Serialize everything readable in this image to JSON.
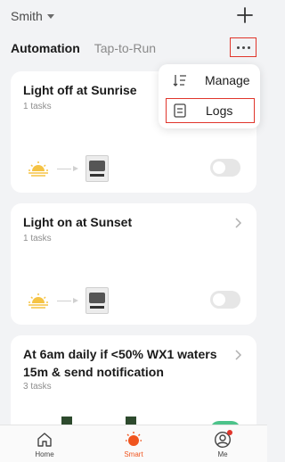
{
  "header": {
    "home_name": "Smith"
  },
  "tabs": [
    {
      "label": "Automation",
      "active": true
    },
    {
      "label": "Tap-to-Run",
      "active": false
    }
  ],
  "menu": {
    "items": [
      {
        "label": "Manage",
        "icon": "sort-list-icon"
      },
      {
        "label": "Logs",
        "icon": "log-document-icon"
      }
    ]
  },
  "cards": [
    {
      "title": "Light off at Sunrise",
      "subtitle": "1 tasks",
      "enabled": false
    },
    {
      "title": "Light on at Sunset",
      "subtitle": "1 tasks",
      "enabled": false
    },
    {
      "title": "At 6am daily if <50% WX1 waters 15m & send notification",
      "subtitle": "3 tasks",
      "enabled": true
    }
  ],
  "tabbar": [
    {
      "label": "Home",
      "icon": "home-icon",
      "active": false
    },
    {
      "label": "Smart",
      "icon": "smart-sun-icon",
      "active": true
    },
    {
      "label": "Me",
      "icon": "profile-icon",
      "active": false,
      "notification": true
    }
  ],
  "colors": {
    "accent": "#f0551f",
    "highlight": "#e0352b",
    "background": "#f2f3f5"
  }
}
